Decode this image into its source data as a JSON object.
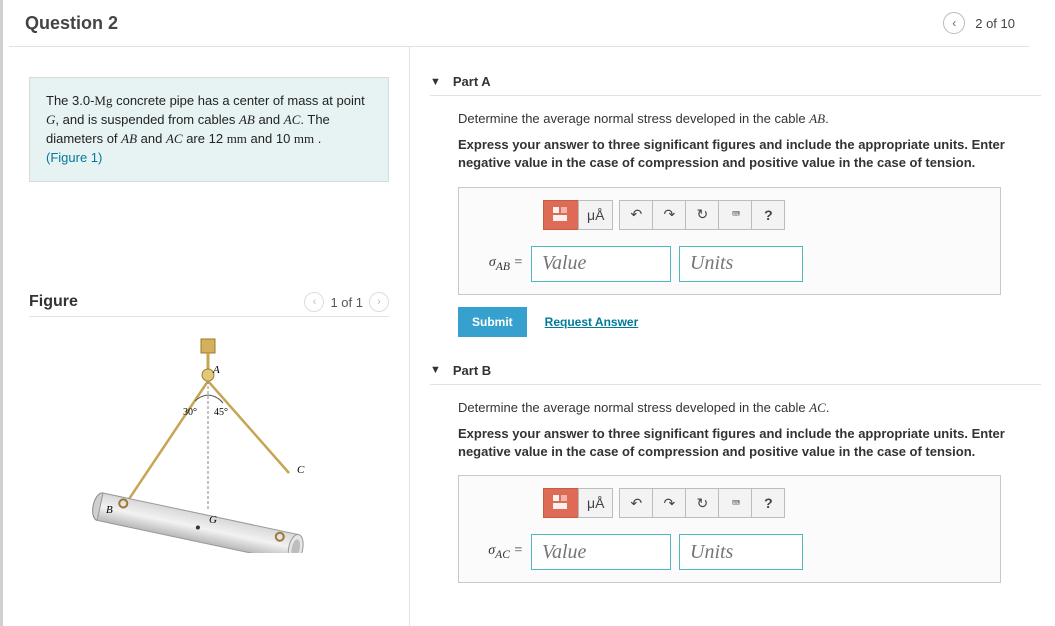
{
  "header": {
    "question_title": "Question 2",
    "nav_count": "2 of 10"
  },
  "problem": {
    "line1a": "The 3.0-",
    "line1b": "Mg",
    "line1c": " concrete pipe has a center of mass at point ",
    "line2a": "G",
    "line2b": ", and is suspended from cables ",
    "line2c": "AB",
    "line2d": " and ",
    "line2e": "AC",
    "line2f": ". The diameters of ",
    "line2g": "AB",
    "line2h": " and ",
    "line2i": "AC",
    "line2j": " are 12 ",
    "line2k": "mm",
    "line2l": " and 10 ",
    "line2m": "mm",
    "line2n": " .",
    "figlink": "(Figure 1)"
  },
  "figure": {
    "heading": "Figure",
    "counter": "1 of 1",
    "labels": {
      "A": "A",
      "B": "B",
      "C": "C",
      "G": "G",
      "a30": "30°",
      "a45": "45°"
    }
  },
  "toolbar": {
    "mu_label": "μÅ",
    "undo": "↶",
    "redo": "↷",
    "reset": "↻",
    "kbd": "⌨",
    "help": "?"
  },
  "partA": {
    "label": "Part A",
    "prompt_pre": "Determine the average normal stress developed in the cable ",
    "prompt_var": "AB",
    "prompt_post": ".",
    "instr": "Express your answer to three significant figures and include the appropriate units. Enter negative value in the case of compression and positive value in the case of tension.",
    "sigma_pre": "σ",
    "sigma_sub": "AB",
    "sigma_eq": " =",
    "value_ph": "Value",
    "units_ph": "Units",
    "submit": "Submit",
    "request": "Request Answer"
  },
  "partB": {
    "label": "Part B",
    "prompt_pre": "Determine the average normal stress developed in the cable ",
    "prompt_var": "AC",
    "prompt_post": ".",
    "instr": "Express your answer to three significant figures and include the appropriate units. Enter negative value in the case of compression and positive value in the case of tension.",
    "sigma_pre": "σ",
    "sigma_sub": "AC",
    "sigma_eq": " =",
    "value_ph": "Value",
    "units_ph": "Units"
  }
}
